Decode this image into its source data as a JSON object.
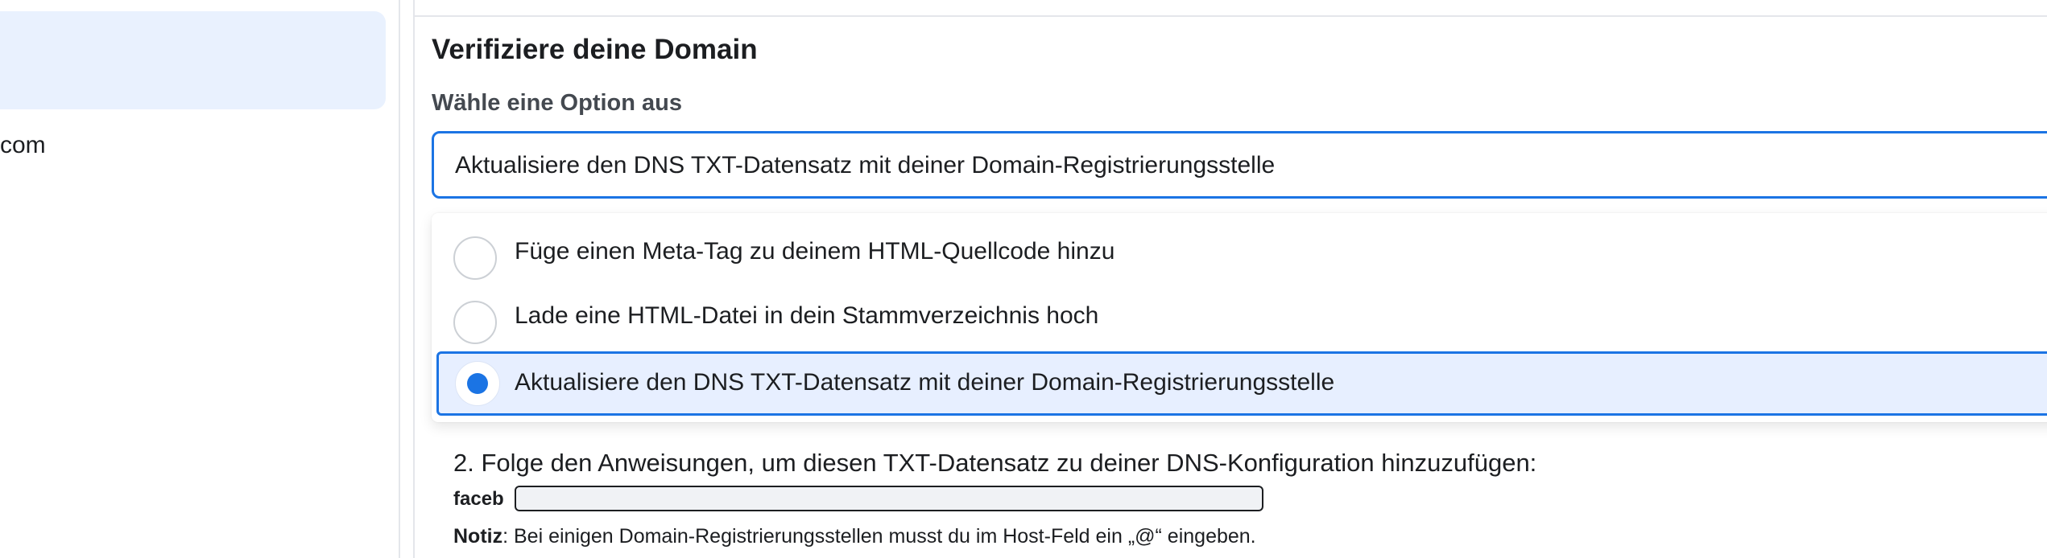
{
  "sidebar": {
    "item_text": "com"
  },
  "main": {
    "section_title": "Verifiziere deine Domain",
    "option_label": "Wähle eine Option aus",
    "select": {
      "value": "Aktualisiere den DNS TXT-Datensatz mit deiner Domain-Registrierungsstelle"
    },
    "options": [
      {
        "label": "Füge einen Meta-Tag zu deinem HTML-Quellcode hinzu",
        "selected": false
      },
      {
        "label": "Lade eine HTML-Datei in dein Stammverzeichnis hoch",
        "selected": false
      },
      {
        "label": "Aktualisiere den DNS TXT-Datensatz mit deiner Domain-Registrierungsstelle",
        "selected": true
      }
    ],
    "instructions": "2. Folge den Anweisungen, um diesen TXT-Datensatz zu deiner DNS-Konfiguration hinzuzufügen:",
    "record_prefix": "faceb",
    "note_label": "Notiz",
    "note_text": ": Bei einigen Domain-Registrierungsstellen musst du im Host-Feld ein „@“ eingeben."
  },
  "colors": {
    "accent": "#1b74e4",
    "selected_bg": "#e7efff",
    "sidebar_selected_bg": "#e9f1fe",
    "divider": "#e4e6eb"
  }
}
